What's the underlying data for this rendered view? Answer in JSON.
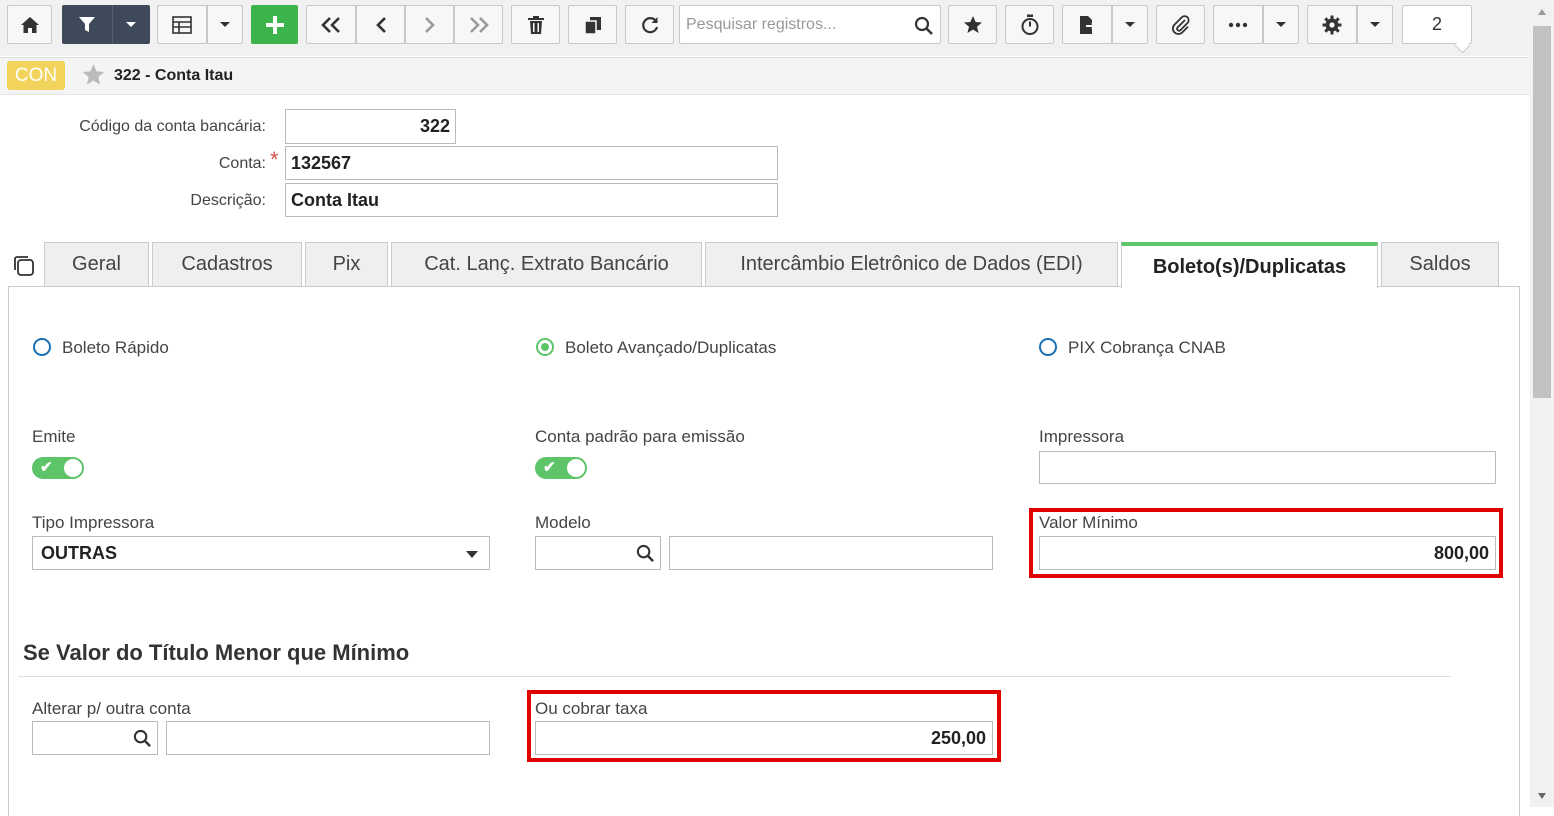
{
  "toolbar": {
    "search_placeholder": "Pesquisar registros...",
    "record_counter": "2",
    "buttons": [
      "home-icon",
      "filter-icon",
      "chevron-down-icon",
      "grid-icon",
      "chevron-down-icon",
      "plus-icon",
      "first-icon",
      "prev-icon",
      "next-icon",
      "last-icon",
      "trash-icon",
      "copy-icon",
      "refresh-icon",
      "search-icon",
      "star-icon",
      "timer-icon",
      "export-icon",
      "chevron-down-icon",
      "paperclip-icon",
      "more-icon",
      "chevron-down-icon",
      "gear-icon",
      "chevron-down-icon"
    ]
  },
  "breadcrumb": {
    "badge": "CON",
    "title": "322 - Conta Itau"
  },
  "form": {
    "codigo_label": "Código da conta bancária:",
    "codigo_value": "322",
    "conta_label": "Conta:",
    "required_mark": "*",
    "conta_value": "132567",
    "descricao_label": "Descrição:",
    "descricao_value": "Conta Itau"
  },
  "tabs": [
    {
      "label": "Geral"
    },
    {
      "label": "Cadastros"
    },
    {
      "label": "Pix"
    },
    {
      "label": "Cat. Lanç. Extrato Bancário"
    },
    {
      "label": "Intercâmbio Eletrônico de Dados (EDI)"
    },
    {
      "label": "Boleto(s)/Duplicatas",
      "active": true
    },
    {
      "label": "Saldos"
    }
  ],
  "boleto": {
    "radios": [
      {
        "label": "Boleto Rápido",
        "checked": false
      },
      {
        "label": "Boleto Avançado/Duplicatas",
        "checked": true
      },
      {
        "label": "PIX Cobrança CNAB",
        "checked": false
      }
    ],
    "emite_label": "Emite",
    "emite_on": true,
    "conta_padrao_label": "Conta padrão para emissão",
    "conta_padrao_on": true,
    "impressora_label": "Impressora",
    "impressora_value": "",
    "tipo_impressora_label": "Tipo Impressora",
    "tipo_impressora_value": "OUTRAS",
    "modelo_label": "Modelo",
    "modelo_code": "",
    "modelo_desc": "",
    "valor_minimo_label": "Valor Mínimo",
    "valor_minimo_value": "800,00",
    "section_title": "Se Valor do Título Menor que Mínimo",
    "alterar_label": "Alterar p/ outra conta",
    "alterar_code": "",
    "alterar_desc": "",
    "cobrar_taxa_label": "Ou cobrar taxa",
    "cobrar_taxa_value": "250,00"
  },
  "colors": {
    "accent_green": "#5dc46a",
    "toolbar_dark": "#3e4a5a",
    "add_green": "#3cb44b",
    "badge_yellow": "#f2d35c",
    "highlight_red": "#e00000",
    "radio_blue": "#1a6fb5"
  }
}
